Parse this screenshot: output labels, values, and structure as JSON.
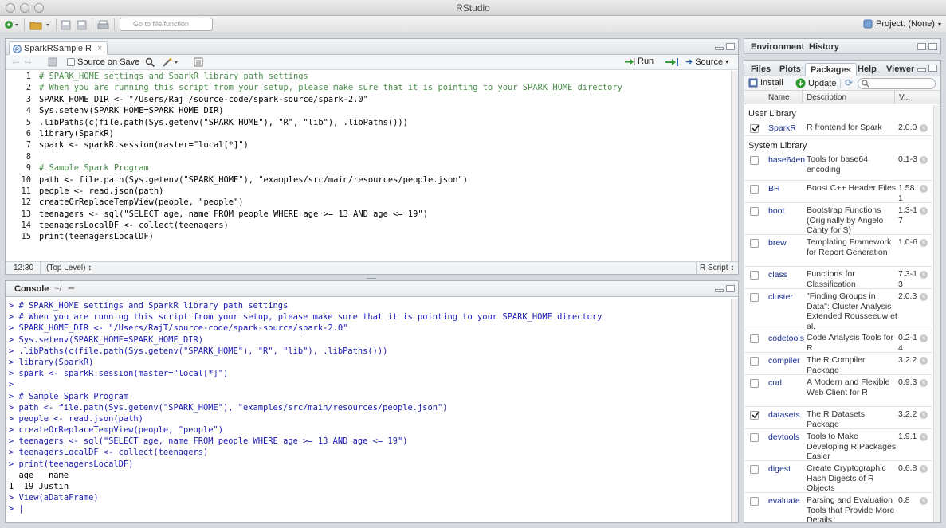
{
  "app": {
    "title": "RStudio"
  },
  "toolbar": {
    "goto_placeholder": "Go to file/function",
    "project_label": "Project: (None)"
  },
  "editor": {
    "tab_label": "SparkRSample.R",
    "source_on_save_label": "Source on Save",
    "run_label": "Run",
    "source_label": "Source",
    "lines": [
      {
        "n": "1",
        "text": "# SPARK_HOME settings and SparkR library path settings"
      },
      {
        "n": "2",
        "text": "# When you are running this script from your setup, please make sure that it is pointing to your SPARK_HOME directory"
      },
      {
        "n": "3",
        "text": "SPARK_HOME_DIR <- \"/Users/RajT/source-code/spark-source/spark-2.0\""
      },
      {
        "n": "4",
        "text": "Sys.setenv(SPARK_HOME=SPARK_HOME_DIR)"
      },
      {
        "n": "5",
        "text": ".libPaths(c(file.path(Sys.getenv(\"SPARK_HOME\"), \"R\", \"lib\"), .libPaths()))"
      },
      {
        "n": "6",
        "text": "library(SparkR)"
      },
      {
        "n": "7",
        "text": "spark <- sparkR.session(master=\"local[*]\")"
      },
      {
        "n": "8",
        "text": ""
      },
      {
        "n": "9",
        "text": "# Sample Spark Program"
      },
      {
        "n": "10",
        "text": "path <- file.path(Sys.getenv(\"SPARK_HOME\"), \"examples/src/main/resources/people.json\")"
      },
      {
        "n": "11",
        "text": "people <- read.json(path)"
      },
      {
        "n": "12",
        "text": "createOrReplaceTempView(people, \"people\")"
      },
      {
        "n": "13",
        "text": "teenagers <- sql(\"SELECT age, name FROM people WHERE age >= 13 AND age <= 19\")"
      },
      {
        "n": "14",
        "text": "teenagersLocalDF <- collect(teenagers)"
      },
      {
        "n": "15",
        "text": "print(teenagersLocalDF)"
      }
    ],
    "status_position": "12:30",
    "status_scope": "(Top Level) ↕",
    "status_filetype": "R Script ↕"
  },
  "console": {
    "tab_label": "Console",
    "path": "~/",
    "lines": [
      {
        "p": "> ",
        "text": "# SPARK_HOME settings and SparkR library path settings",
        "k": "cin"
      },
      {
        "p": "> ",
        "text": "# When you are running this script from your setup, please make sure that it is pointing to your SPARK_HOME directory",
        "k": "cin"
      },
      {
        "p": "> ",
        "text": "SPARK_HOME_DIR <- \"/Users/RajT/source-code/spark-source/spark-2.0\"",
        "k": "cin"
      },
      {
        "p": "> ",
        "text": "Sys.setenv(SPARK_HOME=SPARK_HOME_DIR)",
        "k": "cin"
      },
      {
        "p": "> ",
        "text": ".libPaths(c(file.path(Sys.getenv(\"SPARK_HOME\"), \"R\", \"lib\"), .libPaths()))",
        "k": "cin"
      },
      {
        "p": "> ",
        "text": "library(SparkR)",
        "k": "cin"
      },
      {
        "p": "> ",
        "text": "spark <- sparkR.session(master=\"local[*]\")",
        "k": "cin"
      },
      {
        "p": "> ",
        "text": "",
        "k": "cin"
      },
      {
        "p": "> ",
        "text": "# Sample Spark Program",
        "k": "cin"
      },
      {
        "p": "> ",
        "text": "path <- file.path(Sys.getenv(\"SPARK_HOME\"), \"examples/src/main/resources/people.json\")",
        "k": "cin"
      },
      {
        "p": "> ",
        "text": "people <- read.json(path)",
        "k": "cin"
      },
      {
        "p": "> ",
        "text": "createOrReplaceTempView(people, \"people\")",
        "k": "cin"
      },
      {
        "p": "> ",
        "text": "teenagers <- sql(\"SELECT age, name FROM people WHERE age >= 13 AND age <= 19\")",
        "k": "cin"
      },
      {
        "p": "> ",
        "text": "teenagersLocalDF <- collect(teenagers)",
        "k": "cin"
      },
      {
        "p": "> ",
        "text": "print(teenagersLocalDF)",
        "k": "cin"
      },
      {
        "p": "",
        "text": "  age   name",
        "k": "cout"
      },
      {
        "p": "",
        "text": "1  19 Justin",
        "k": "cout"
      },
      {
        "p": "> ",
        "text": "View(aDataFrame)",
        "k": "cin"
      },
      {
        "p": "> ",
        "text": "|",
        "k": "cin"
      }
    ]
  },
  "env_pane": {
    "tabs": [
      "Environment",
      "History"
    ]
  },
  "files_pane": {
    "tabs": [
      "Files",
      "Plots",
      "Packages",
      "Help",
      "Viewer"
    ],
    "install_label": "Install",
    "update_label": "Update",
    "columns": [
      "Name",
      "Description",
      "V..."
    ],
    "user_library_label": "User Library",
    "system_library_label": "System Library",
    "user_packages": [
      {
        "name": "SparkR",
        "desc": "R frontend for Spark",
        "version": "2.0.0",
        "checked": true
      }
    ],
    "system_packages": [
      {
        "name": "base64enc",
        "desc": "Tools for base64 encoding",
        "version": "0.1-3",
        "checked": false
      },
      {
        "name": "BH",
        "desc": "Boost C++ Header Files",
        "version": "1.58.1",
        "checked": false
      },
      {
        "name": "boot",
        "desc": "Bootstrap Functions (Originally by Angelo Canty for S)",
        "version": "1.3-17",
        "checked": false
      },
      {
        "name": "brew",
        "desc": "Templating Framework for Report Generation",
        "version": "1.0-6",
        "checked": false
      },
      {
        "name": "class",
        "desc": "Functions for Classification",
        "version": "7.3-13",
        "checked": false
      },
      {
        "name": "cluster",
        "desc": "\"Finding Groups in Data\": Cluster Analysis Extended Rousseeuw et al.",
        "version": "2.0.3",
        "checked": false
      },
      {
        "name": "codetools",
        "desc": "Code Analysis Tools for R",
        "version": "0.2-14",
        "checked": false
      },
      {
        "name": "compiler",
        "desc": "The R Compiler Package",
        "version": "3.2.2",
        "checked": false
      },
      {
        "name": "curl",
        "desc": "A Modern and Flexible Web Client for R",
        "version": "0.9.3",
        "checked": false
      },
      {
        "name": "datasets",
        "desc": "The R Datasets Package",
        "version": "3.2.2",
        "checked": true
      },
      {
        "name": "devtools",
        "desc": "Tools to Make Developing R Packages Easier",
        "version": "1.9.1",
        "checked": false
      },
      {
        "name": "digest",
        "desc": "Create Cryptographic Hash Digests of R Objects",
        "version": "0.6.8",
        "checked": false
      },
      {
        "name": "evaluate",
        "desc": "Parsing and Evaluation Tools that Provide More Details",
        "version": "0.8",
        "checked": false
      }
    ]
  }
}
